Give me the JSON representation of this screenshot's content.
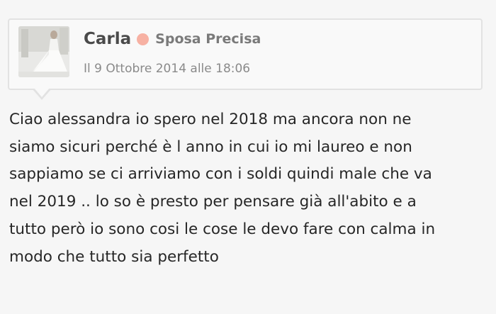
{
  "post": {
    "author": {
      "name": "Carla",
      "rank": "Sposa Precisa",
      "status_color": "#f7b1a3",
      "avatar_icon": "bride-dress-photo"
    },
    "date": "Il 9 Ottobre 2014 alle 18:06",
    "message_lines": [
      "Ciao alessandra io spero nel 2018 ma ancora non ne",
      "siamo sicuri perché è l anno in cui io mi laureo e non",
      "sappiamo se ci arriviamo con i soldi quindi male che va",
      "nel 2019 .. lo so è presto per pensare già all'abito e a",
      "tutto però io sono cosi le cose le devo fare con calma in",
      "modo che tutto sia perfetto"
    ]
  }
}
